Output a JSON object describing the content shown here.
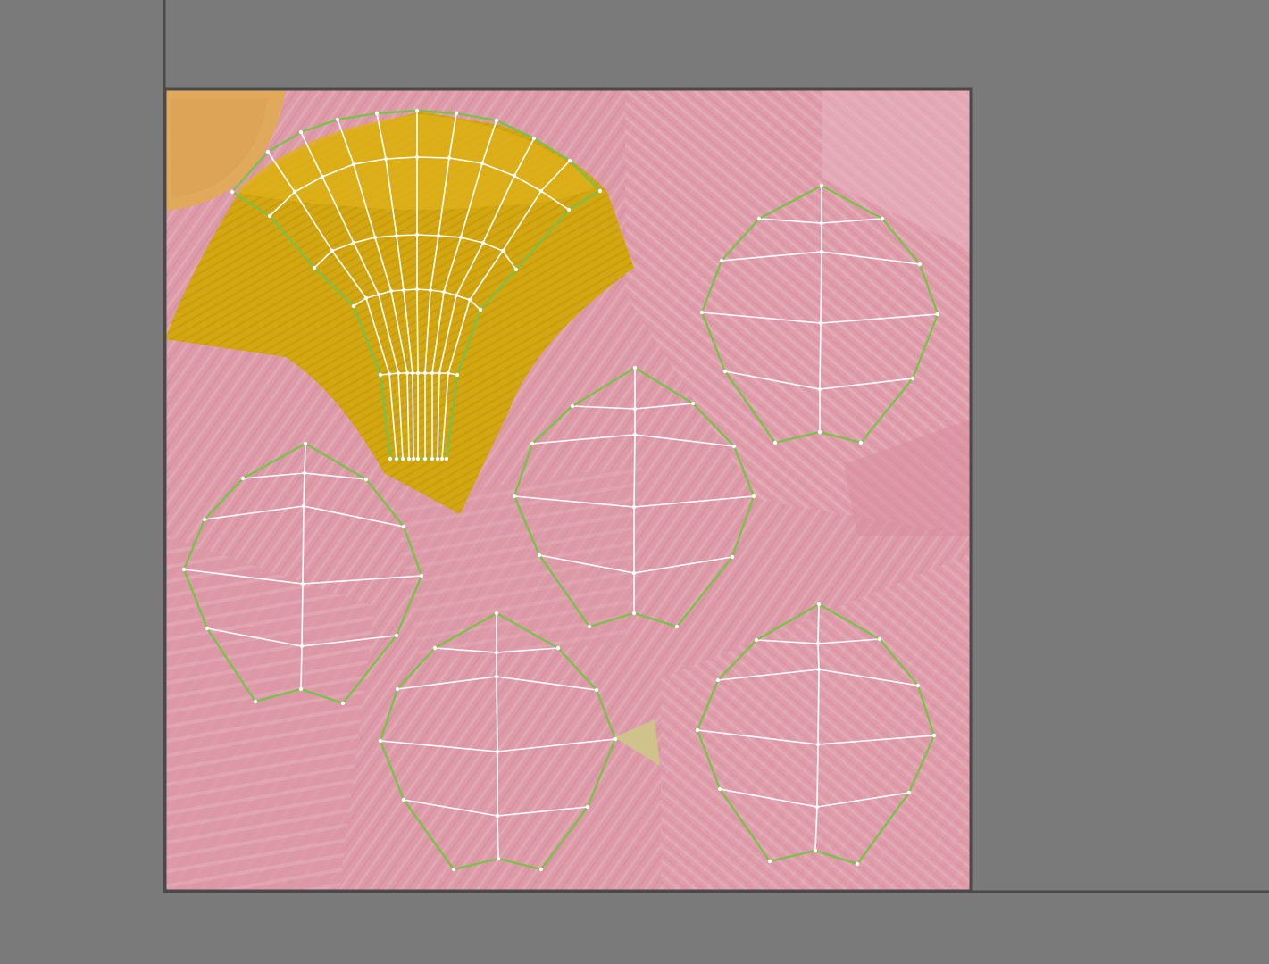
{
  "canvas": {
    "background": "#7a7a7a",
    "axis_color": "#4a4a4a"
  },
  "texture": {
    "base_color": "#dd9aa8",
    "streak_color": "#e9b4c0",
    "shadow_color": "#d6899b",
    "stamen_color": "#d2a612",
    "stamen_dark": "#c49a08",
    "peach_color": "#e1a95c",
    "khaki_color": "#cfc28a"
  },
  "uv_overlay": {
    "edge_color": "#ffffff",
    "border_color": "#79c24a",
    "vertex_color": "#ffffff",
    "shells": [
      {
        "name": "stamen-fan",
        "kind": "fan"
      },
      {
        "name": "petal-shell-1",
        "kind": "petal"
      },
      {
        "name": "petal-shell-2",
        "kind": "petal"
      },
      {
        "name": "petal-shell-3",
        "kind": "petal"
      },
      {
        "name": "petal-shell-4",
        "kind": "petal"
      },
      {
        "name": "petal-shell-5",
        "kind": "petal"
      }
    ]
  }
}
